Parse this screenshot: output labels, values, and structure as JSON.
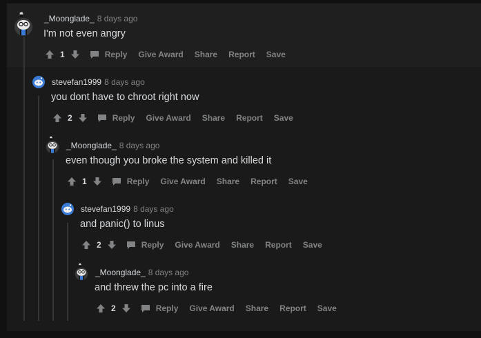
{
  "comments": [
    {
      "author": "_Moonglade_",
      "time": "8 days ago",
      "text": "I'm not even angry",
      "score": "1",
      "avatar": "moonglade-avatar"
    },
    {
      "author": "stevefan1999",
      "time": "8 days ago",
      "text": "you dont have to chroot right now",
      "score": "2",
      "avatar": "snoo-avatar"
    },
    {
      "author": "_Moonglade_",
      "time": "8 days ago",
      "text": "even though you broke the system and killed it",
      "score": "1",
      "avatar": "moonglade-avatar"
    },
    {
      "author": "stevefan1999",
      "time": "8 days ago",
      "text": "and panic() to linus",
      "score": "2",
      "avatar": "snoo-avatar"
    },
    {
      "author": "_Moonglade_",
      "time": "8 days ago",
      "text": "and threw the pc into a fire",
      "score": "2",
      "avatar": "moonglade-avatar"
    }
  ],
  "actions": {
    "reply": "Reply",
    "give_award": "Give Award",
    "share": "Share",
    "report": "Report",
    "save": "Save"
  },
  "colors": {
    "background": "#1a1a1b",
    "text": "#d7dadc",
    "muted": "#818384",
    "thread_line": "#343536",
    "avatar_blue": "#3a7bd5"
  }
}
